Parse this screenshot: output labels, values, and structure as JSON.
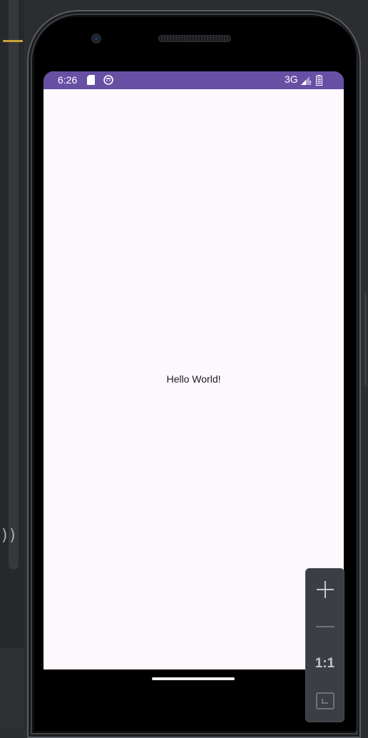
{
  "status_bar": {
    "time": "6:26",
    "network": "3G",
    "background_color": "#6750a4",
    "icons": [
      "sd-card-icon",
      "face-icon",
      "signal-icon",
      "battery-icon"
    ]
  },
  "app": {
    "message": "Hello World!",
    "background_color": "#fdf8fc"
  },
  "zoom_controls": {
    "zoom_in_icon": "plus-icon",
    "zoom_out_icon": "minus-icon",
    "actual_size_label": "1:1",
    "fit_screen_icon": "fit-screen-icon"
  },
  "colors": {
    "ide_background": "#2b2d30",
    "marker": "#c9a33a"
  }
}
